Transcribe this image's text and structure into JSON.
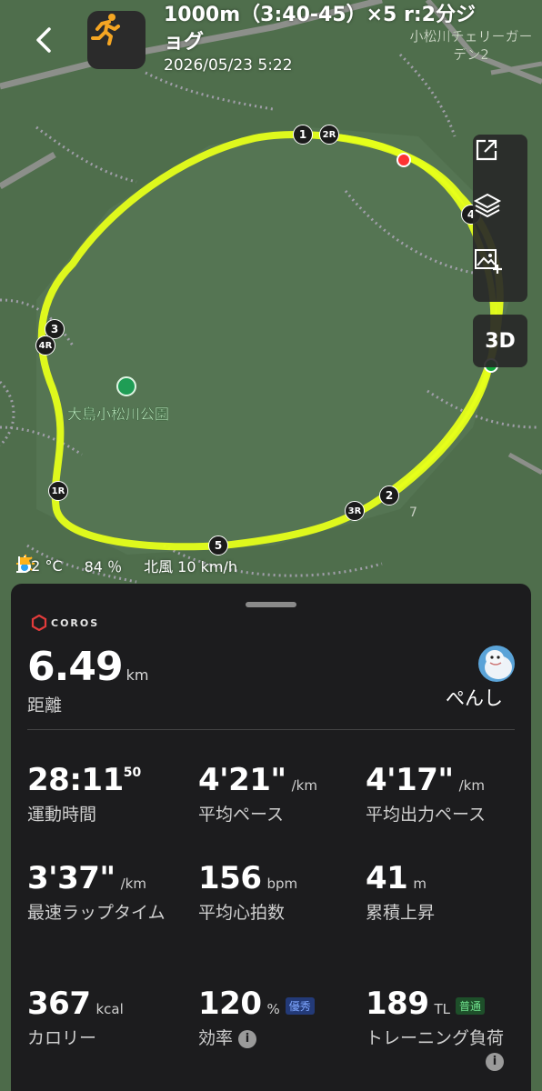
{
  "header": {
    "title": "1000m（3:40-45）×5 r:2分ジョグ",
    "datetime": "2026/05/23 5:22",
    "activity_icon": "running-icon",
    "back_icon": "chevron-left-icon"
  },
  "map": {
    "poi_top_right": "小松川チェリーガーデン2",
    "park_name": "大島小松川公園",
    "misc_label": "7",
    "route_color": "#e6ff1a",
    "markers": [
      "1",
      "2R",
      "4",
      "3",
      "4R",
      "1R",
      "3R",
      "2",
      "5"
    ],
    "tools": {
      "share_icon": "share-icon",
      "layers_icon": "layers-icon",
      "add_photo_icon": "add-photo-icon",
      "view_3d": "3D"
    }
  },
  "weather": {
    "temperature": "12 °C",
    "humidity": "84 ％",
    "wind": "北風 10 km/h"
  },
  "panel": {
    "brand": "COROS",
    "distance": {
      "value": "6.49",
      "unit": "km",
      "label": "距離"
    },
    "user": {
      "name": "ぺんし"
    },
    "stats": [
      {
        "value": "28:11",
        "sub": "50",
        "unit": "",
        "label": "運動時間"
      },
      {
        "value": "4'21\"",
        "unit": "/km",
        "label": "平均ペース"
      },
      {
        "value": "4'17\"",
        "unit": "/km",
        "label": "平均出力ペース"
      },
      {
        "value": "3'37\"",
        "unit": "/km",
        "label": "最速ラップタイム"
      },
      {
        "value": "156",
        "unit": "bpm",
        "label": "平均心拍数"
      },
      {
        "value": "41",
        "unit": "m",
        "label": "累積上昇"
      },
      {
        "value": "367",
        "unit": "kcal",
        "label": "カロリー"
      },
      {
        "value": "120",
        "unit": "%",
        "badge": "優秀",
        "label": "効率"
      },
      {
        "value": "189",
        "unit": "TL",
        "badge": "普通",
        "label": "トレーニング負荷"
      }
    ]
  }
}
